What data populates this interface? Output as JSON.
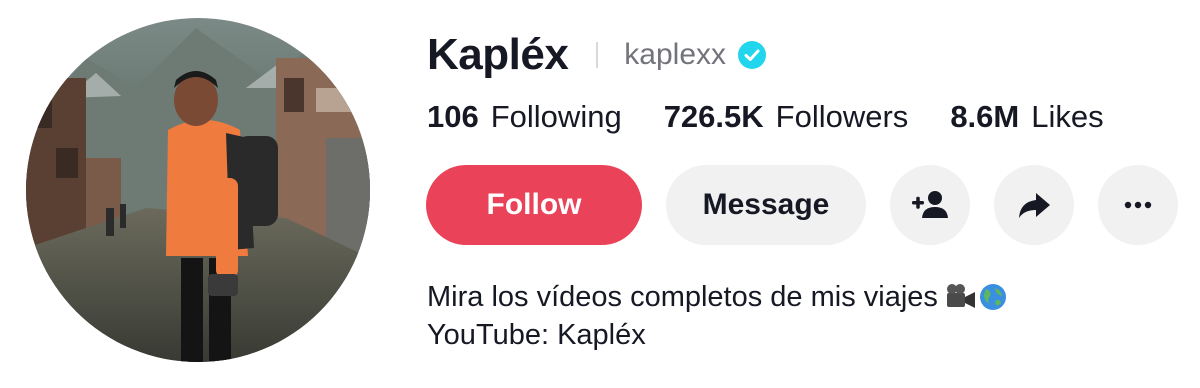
{
  "profile": {
    "display_name": "Kapléx",
    "username": "kaplexx",
    "verified": true,
    "avatar_icon": "profile-photo"
  },
  "stats": [
    {
      "value": "106",
      "label": "Following"
    },
    {
      "value": "726.5K",
      "label": "Followers"
    },
    {
      "value": "8.6M",
      "label": "Likes"
    }
  ],
  "actions": {
    "follow_label": "Follow",
    "message_label": "Message",
    "add_friend_icon": "person-plus-icon",
    "share_icon": "share-arrow-icon",
    "more_icon": "more-dots-icon"
  },
  "bio": {
    "line1": "Mira los vídeos completos de mis viajes",
    "line1_emojis": [
      "movie-camera-emoji",
      "globe-emoji"
    ],
    "line2": "YouTube: Kapléx"
  },
  "colors": {
    "follow_bg": "#ea4359",
    "button_bg": "#f1f1f2",
    "verified": "#20d5ec",
    "muted_text": "#73747b"
  }
}
